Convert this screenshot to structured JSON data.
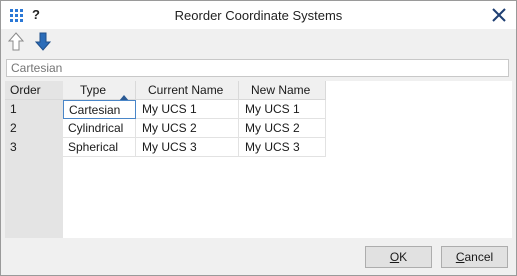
{
  "window": {
    "title": "Reorder Coordinate Systems",
    "help_label": "?",
    "accent_color": "#2b78d6"
  },
  "toolbar": {
    "move_up_icon": "arrow-up-outline-icon",
    "move_down_icon": "arrow-down-filled-icon"
  },
  "filter": {
    "placeholder": "Cartesian"
  },
  "table": {
    "columns": {
      "order": "Order",
      "type": "Type",
      "current_name": "Current Name",
      "new_name": "New Name"
    },
    "sort_column": "Type",
    "sort_direction": "ascending",
    "rows": [
      {
        "order": "1",
        "type": "Cartesian",
        "current_name": "My UCS 1",
        "new_name": "My UCS 1"
      },
      {
        "order": "2",
        "type": "Cylindrical",
        "current_name": "My UCS 2",
        "new_name": "My UCS 2"
      },
      {
        "order": "3",
        "type": "Spherical",
        "current_name": "My UCS 3",
        "new_name": "My UCS 3"
      }
    ]
  },
  "buttons": {
    "ok_mnemonic": "O",
    "ok_rest": "K",
    "cancel_mnemonic": "C",
    "cancel_rest": "ancel"
  }
}
